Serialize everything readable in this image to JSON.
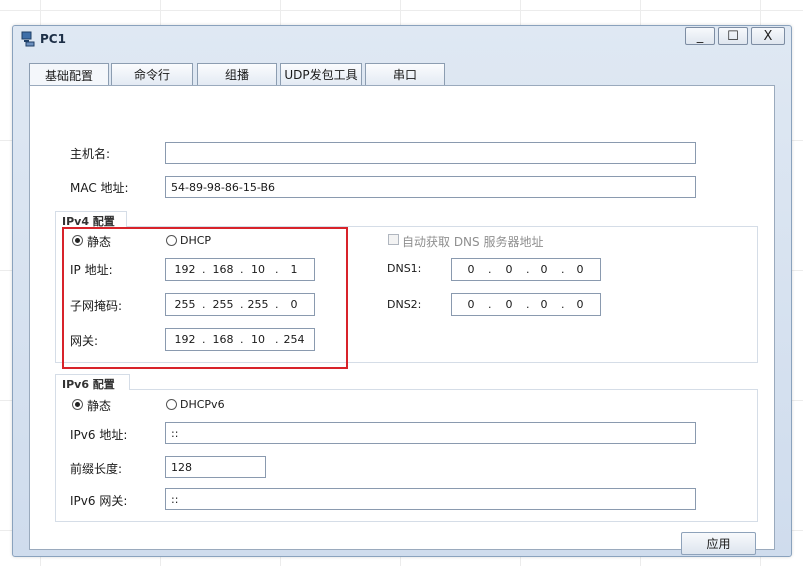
{
  "window": {
    "title": "PC1",
    "min_symbol": "_",
    "max_symbol": "☐",
    "close_symbol": "X"
  },
  "tabs": [
    {
      "label": "基础配置",
      "active": true
    },
    {
      "label": "命令行"
    },
    {
      "label": "组播"
    },
    {
      "label": "UDP发包工具"
    },
    {
      "label": "串口"
    }
  ],
  "basic": {
    "hostname_label": "主机名:",
    "hostname_value": "",
    "mac_label": "MAC 地址:",
    "mac_value": "54-89-98-86-15-B6"
  },
  "ipv4": {
    "group_title": "IPv4 配置",
    "static_label": "静态",
    "dhcp_label": "DHCP",
    "auto_dns_label": "自动获取 DNS 服务器地址",
    "ip_label": "IP 地址:",
    "ip": [
      "192",
      "168",
      "10",
      "1"
    ],
    "mask_label": "子网掩码:",
    "mask": [
      "255",
      "255",
      "255",
      "0"
    ],
    "gateway_label": "网关:",
    "gateway": [
      "192",
      "168",
      "10",
      "254"
    ],
    "dns1_label": "DNS1:",
    "dns1": [
      "0",
      "0",
      "0",
      "0"
    ],
    "dns2_label": "DNS2:",
    "dns2": [
      "0",
      "0",
      "0",
      "0"
    ]
  },
  "ipv6": {
    "group_title": "IPv6 配置",
    "static_label": "静态",
    "dhcp_label": "DHCPv6",
    "ip_label": "IPv6 地址:",
    "ip_value": "::",
    "prefix_label": "前缀长度:",
    "prefix_value": "128",
    "gateway_label": "IPv6 网关:",
    "gateway_value": "::"
  },
  "apply_label": "应用"
}
